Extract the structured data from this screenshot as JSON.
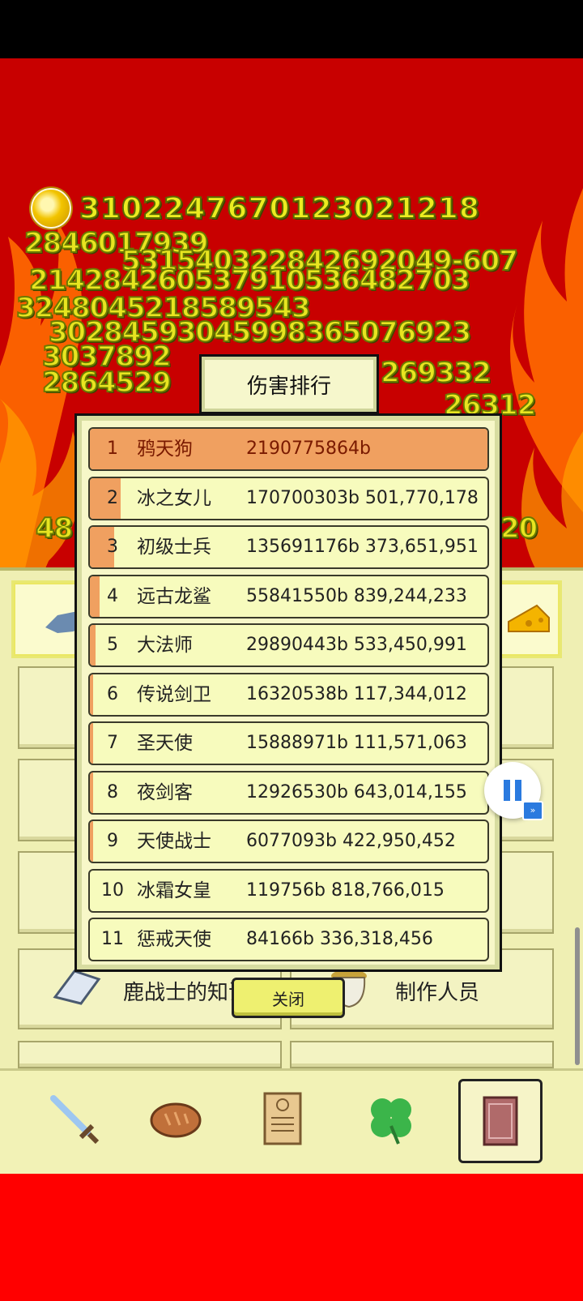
{
  "currency": {
    "value": "3102247670123021218"
  },
  "floating_damage_numbers": [
    "2846017939",
    "531540322842692049-607",
    "214284260537910536482703",
    "3248045218589543",
    "30284593045998365076923",
    "3037892",
    "2864529",
    "269332",
    "26312",
    "48",
    "20"
  ],
  "dialog": {
    "title": "伤害排行",
    "close_label": "关闭",
    "rows": [
      {
        "rank": "1",
        "name": "鸦天狗",
        "damage": "2190775864b",
        "share": 1.0
      },
      {
        "rank": "2",
        "name": "冰之女儿",
        "damage": "170700303b 501,770,178",
        "share": 0.078
      },
      {
        "rank": "3",
        "name": "初级士兵",
        "damage": "135691176b 373,651,951",
        "share": 0.062
      },
      {
        "rank": "4",
        "name": "远古龙鲨",
        "damage": "55841550b 839,244,233",
        "share": 0.025
      },
      {
        "rank": "5",
        "name": "大法师",
        "damage": "29890443b 533,450,991",
        "share": 0.014
      },
      {
        "rank": "6",
        "name": "传说剑卫",
        "damage": "16320538b 117,344,012",
        "share": 0.007
      },
      {
        "rank": "7",
        "name": "圣天使",
        "damage": "15888971b 111,571,063",
        "share": 0.007
      },
      {
        "rank": "8",
        "name": "夜剑客",
        "damage": "12926530b 643,014,155",
        "share": 0.006
      },
      {
        "rank": "9",
        "name": "天使战士",
        "damage": "6077093b 422,950,452",
        "share": 0.003
      },
      {
        "rank": "10",
        "name": "冰霜女皇",
        "damage": "119756b 818,766,015",
        "share": 0.0
      },
      {
        "rank": "11",
        "name": "惩戒天使",
        "damage": "84166b 336,318,456",
        "share": 0.0
      }
    ]
  },
  "menu": {
    "items": [
      {
        "label": "鹿战士的知识"
      },
      {
        "label": "制作人员"
      }
    ]
  },
  "bottom_nav": {
    "items": [
      {
        "icon": "sword-icon"
      },
      {
        "icon": "bread-icon"
      },
      {
        "icon": "scroll-icon"
      },
      {
        "icon": "clover-icon"
      },
      {
        "icon": "book-icon",
        "active": true
      }
    ]
  },
  "colors": {
    "background_red": "#c80000",
    "panel": "#efefb3",
    "row_fill": "#f7fbbd",
    "rank_bar": "#f0a060",
    "number_yellow": "#ecec20"
  }
}
